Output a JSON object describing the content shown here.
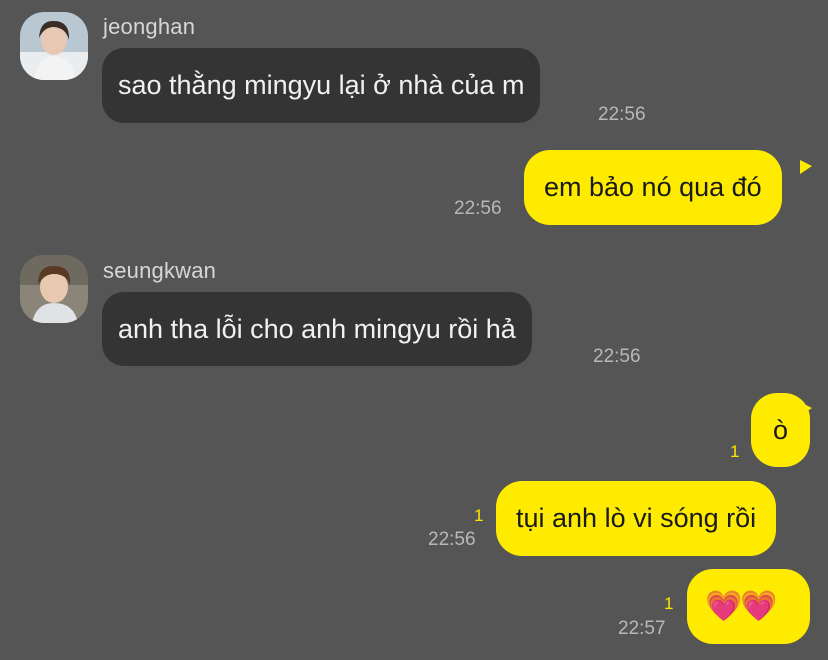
{
  "messages": [
    {
      "sender": "jeonghan",
      "text": "sao thằng mingyu lại ở nhà của m",
      "time": "22:56",
      "avatar_icon": "profile-photo"
    },
    {
      "sender": "me",
      "text": "em bảo nó qua đó",
      "time": "22:56"
    },
    {
      "sender": "seungkwan",
      "text": "anh tha lỗi cho anh mingyu rồi hả",
      "time": "22:56",
      "avatar_icon": "profile-photo"
    },
    {
      "sender": "me",
      "text": "ò",
      "unread": "1"
    },
    {
      "sender": "me",
      "text": "tụi anh lò vi sóng rồi",
      "time": "22:56",
      "unread": "1"
    },
    {
      "sender": "me",
      "text": "💗💗",
      "time": "22:57",
      "unread": "1"
    }
  ],
  "colors": {
    "background": "#555556",
    "incoming_bubble": "#343434",
    "outgoing_bubble": "#ffeb00",
    "unread_count": "#ffe600"
  }
}
